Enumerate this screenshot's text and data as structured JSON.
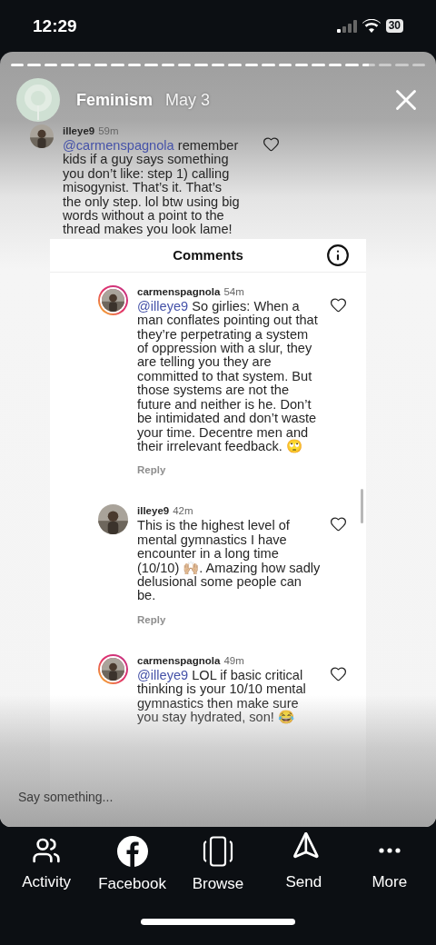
{
  "status_bar": {
    "time": "12:29",
    "battery": "30"
  },
  "story": {
    "segments": [
      {
        "level": 1
      },
      {
        "level": 1
      },
      {
        "level": 1
      },
      {
        "level": 1
      },
      {
        "level": 1
      },
      {
        "level": 1
      },
      {
        "level": 1
      },
      {
        "level": 1
      },
      {
        "level": 1
      },
      {
        "level": 1
      },
      {
        "level": 1
      },
      {
        "level": 1
      },
      {
        "level": 1
      },
      {
        "level": 1
      },
      {
        "level": 1
      },
      {
        "level": 1
      },
      {
        "level": 1
      },
      {
        "level": 1
      },
      {
        "level": 1
      },
      {
        "level": 1
      },
      {
        "level": 1
      },
      {
        "level": 0.5
      },
      {
        "level": 0
      },
      {
        "level": 0
      },
      {
        "level": 0
      }
    ],
    "account": "Feminism",
    "date": "May 3"
  },
  "story_comment": {
    "user": "illeye9",
    "time": "59m",
    "mention": "@carmenspagnola",
    "text": "remember kids if a guy says something you don’t like: step 1) calling misogynist. That’s it. That’s the only step. lol btw using big words without a point to the thread makes you look lame!",
    "story_ring": false
  },
  "comments_panel": {
    "title": "Comments",
    "comments": [
      {
        "user": "carmenspagnola",
        "time": "54m",
        "mention": "@illeye9",
        "text": "So girlies: When a man conflates pointing out that they’re perpetrating a system of oppression with a slur, they are telling you they are committed to that system. But those systems are not the future and neither is he. Don’t be intimidated and don’t waste your time. Decentre men and their irrelevant feedback. 🙄",
        "reply": "Reply",
        "story_ring": true
      },
      {
        "user": "illeye9",
        "time": "42m",
        "text": "This is the highest level of mental gymnastics I have encounter in a long time (10/10) 🙌🏼. Amazing how sadly delusional some people can be.",
        "reply": "Reply",
        "story_ring": false
      },
      {
        "user": "carmenspagnola",
        "time": "49m",
        "mention": "@illeye9",
        "text": "LOL if basic critical thinking is your 10/10 mental gymnastics then make sure you stay hydrated, son! 😂",
        "story_ring": true
      }
    ]
  },
  "message_field": {
    "placeholder": "Say something..."
  },
  "actions": [
    {
      "label": "Activity",
      "kind": "people"
    },
    {
      "label": "Facebook",
      "kind": "facebook"
    },
    {
      "label": "Browse",
      "kind": "browse"
    },
    {
      "label": "Send",
      "kind": "send"
    },
    {
      "label": "More",
      "kind": "more"
    }
  ]
}
